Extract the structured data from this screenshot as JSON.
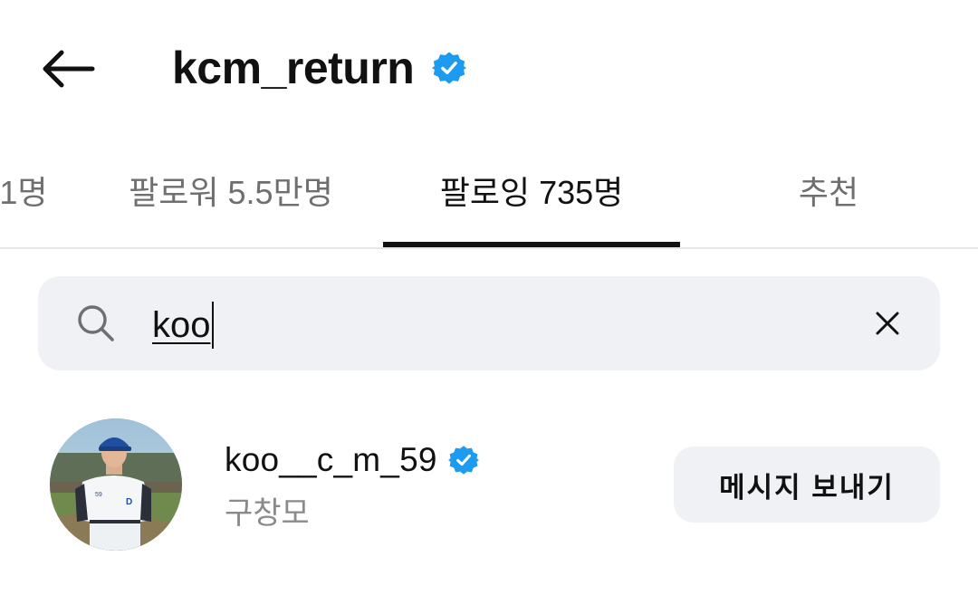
{
  "header": {
    "title": "kcm_return",
    "back_icon": "arrow-left-icon",
    "verified_icon": "verified-badge-icon"
  },
  "tabs": [
    {
      "label": "- 1명",
      "active": false
    },
    {
      "label": "팔로워 5.5만명",
      "active": false
    },
    {
      "label": "팔로잉 735명",
      "active": true
    },
    {
      "label": "추천",
      "active": false
    }
  ],
  "search": {
    "value": "koo",
    "search_icon": "search-icon",
    "clear_icon": "close-icon"
  },
  "results": [
    {
      "username": "koo__c_m_59",
      "display_name": "구창모",
      "verified": true,
      "button_label": "메시지 보내기"
    }
  ],
  "colors": {
    "verified": "#1d9bf0",
    "text_primary": "#111111",
    "text_secondary": "#8a8a8a",
    "input_bg": "#eff1f4"
  }
}
